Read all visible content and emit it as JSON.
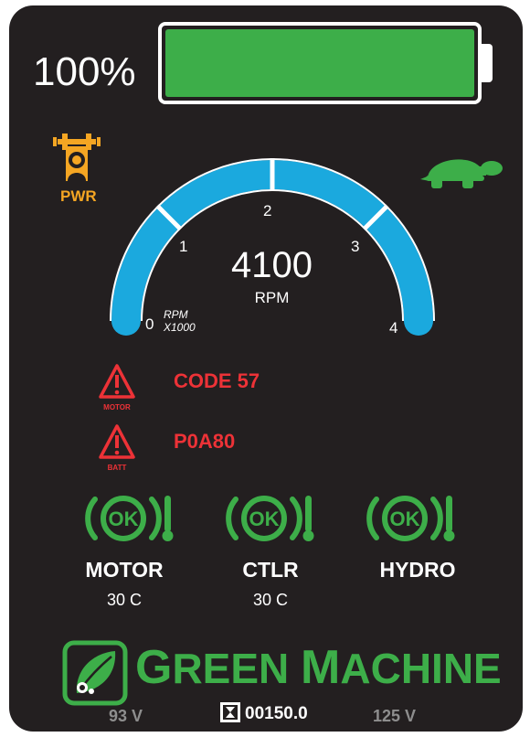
{
  "battery": {
    "percent_label": "100%",
    "charge_fraction": 1.0,
    "fill_color": "#3dae49"
  },
  "indicators": {
    "pwr_icon": "pwr-mode-icon",
    "pwr_label": "PWR",
    "pwr_color": "#f5a623",
    "speed_icon": "turtle-icon",
    "speed_color": "#3dae49"
  },
  "gauge": {
    "value": "4100",
    "unit": "RPM",
    "scale_unit_line1": "RPM",
    "scale_unit_line2": "X1000",
    "ticks": [
      "0",
      "1",
      "2",
      "3",
      "4"
    ],
    "arc_color": "#1ba9de",
    "max": 4
  },
  "faults": [
    {
      "icon": "motor-warning-icon",
      "icon_caption": "MOTOR",
      "code": "CODE 57"
    },
    {
      "icon": "battery-warning-icon",
      "icon_caption": "BATT",
      "code": "P0A80"
    }
  ],
  "fault_color": "#ed3237",
  "temps": [
    {
      "status": "OK",
      "name": "MOTOR",
      "value": "30 C"
    },
    {
      "status": "OK",
      "name": "CTLR",
      "value": "30 C"
    },
    {
      "status": "OK",
      "name": "HYDRO",
      "value": ""
    }
  ],
  "temp_color": "#3dae49",
  "logo": {
    "icon": "leaf-logo-icon",
    "word1_initial": "G",
    "word1_rest": "REEN",
    "word2_initial": "M",
    "word2_rest": "ACHINE"
  },
  "footer": {
    "left_voltage": "93 V",
    "hours_icon": "hourglass-icon",
    "hours": "00150.0",
    "right_voltage": "125 V"
  }
}
